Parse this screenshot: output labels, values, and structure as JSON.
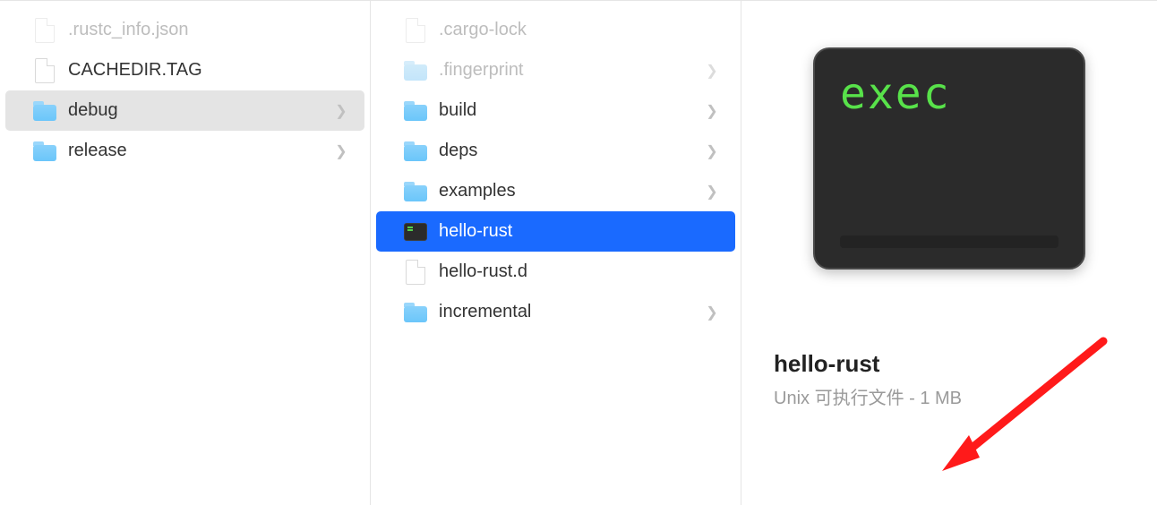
{
  "col1": {
    "items": [
      {
        "kind": "file",
        "label": ".rustc_info.json",
        "dim": true,
        "nav": false
      },
      {
        "kind": "file",
        "label": "CACHEDIR.TAG",
        "dim": false,
        "nav": false
      },
      {
        "kind": "folder",
        "label": "debug",
        "dim": false,
        "nav": true,
        "selected": "grey"
      },
      {
        "kind": "folder",
        "label": "release",
        "dim": false,
        "nav": true
      }
    ]
  },
  "col2": {
    "items": [
      {
        "kind": "file",
        "label": ".cargo-lock",
        "dim": true,
        "nav": false
      },
      {
        "kind": "folder",
        "label": ".fingerprint",
        "dim": true,
        "nav": true
      },
      {
        "kind": "folder",
        "label": "build",
        "dim": false,
        "nav": true
      },
      {
        "kind": "folder",
        "label": "deps",
        "dim": false,
        "nav": true
      },
      {
        "kind": "folder",
        "label": "examples",
        "dim": false,
        "nav": true
      },
      {
        "kind": "exec",
        "label": "hello-rust",
        "dim": false,
        "nav": false,
        "selected": "blue"
      },
      {
        "kind": "file",
        "label": "hello-rust.d",
        "dim": false,
        "nav": false
      },
      {
        "kind": "folder",
        "label": "incremental",
        "dim": false,
        "nav": true
      }
    ]
  },
  "preview": {
    "exec_label": "exec",
    "title": "hello-rust",
    "subtitle": "Unix 可执行文件 - 1 MB"
  }
}
